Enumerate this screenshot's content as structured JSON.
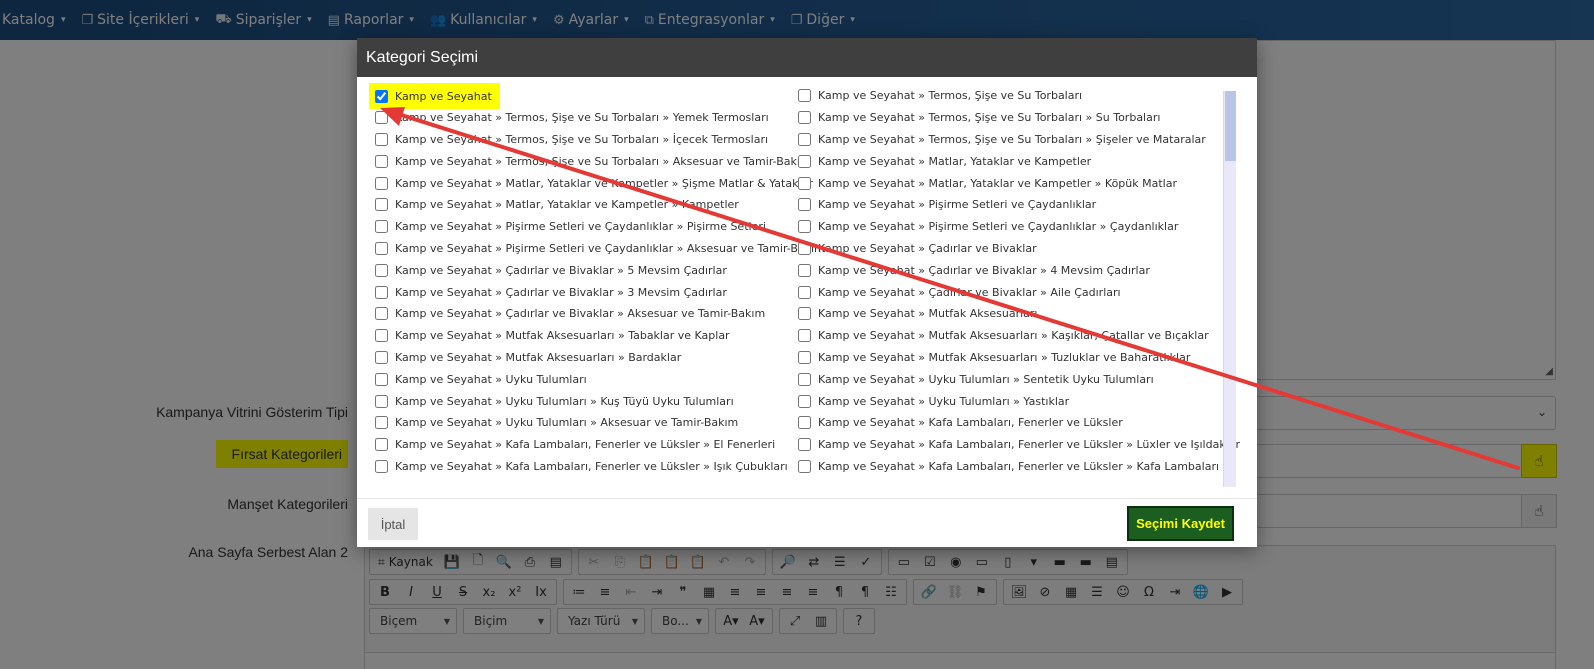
{
  "nav": {
    "items": [
      {
        "label": "Katalog",
        "icon": "none"
      },
      {
        "label": "Site İçerikleri",
        "icon": "copy-icon"
      },
      {
        "label": "Siparişler",
        "icon": "cart-icon"
      },
      {
        "label": "Raporlar",
        "icon": "document-icon"
      },
      {
        "label": "Kullanıcılar",
        "icon": "users-icon"
      },
      {
        "label": "Ayarlar",
        "icon": "gears-icon"
      },
      {
        "label": "Entegrasyonlar",
        "icon": "sitemap-icon"
      },
      {
        "label": "Diğer",
        "icon": "copy-icon"
      }
    ]
  },
  "form": {
    "kampanya_label": "Kampanya Vitrini Gösterim Tipi",
    "firsat_label": "Fırsat Kategorileri",
    "manset_label": "Manşet Kategorileri",
    "serbest_label": "Ana Sayfa Serbest Alan 2"
  },
  "editor": {
    "source_label": "Kaynak",
    "format_combo": "Biçem",
    "style_combo": "Biçim",
    "font_combo": "Yazı Türü",
    "size_combo": "Bo..."
  },
  "modal": {
    "title": "Kategori Seçimi",
    "cancel_label": "İptal",
    "save_label": "Seçimi Kaydet",
    "left_items": [
      {
        "label": "Kamp ve Seyahat",
        "checked": true
      },
      {
        "label": "Kamp ve Seyahat » Termos, Şişe ve Su Torbaları » Yemek Termosları",
        "checked": false
      },
      {
        "label": "Kamp ve Seyahat » Termos, Şişe ve Su Torbaları » İçecek Termosları",
        "checked": false
      },
      {
        "label": "Kamp ve Seyahat » Termos, Şişe ve Su Torbaları » Aksesuar ve Tamir-Bakım",
        "checked": false
      },
      {
        "label": "Kamp ve Seyahat » Matlar, Yataklar ve Kampetler » Şişme Matlar & Yataklar",
        "checked": false
      },
      {
        "label": "Kamp ve Seyahat » Matlar, Yataklar ve Kampetler » Kampetler",
        "checked": false
      },
      {
        "label": "Kamp ve Seyahat » Pişirme Setleri ve Çaydanlıklar » Pişirme Setleri",
        "checked": false
      },
      {
        "label": "Kamp ve Seyahat » Pişirme Setleri ve Çaydanlıklar » Aksesuar ve Tamir-Bakım",
        "checked": false
      },
      {
        "label": "Kamp ve Seyahat » Çadırlar ve Bivaklar » 5 Mevsim Çadırlar",
        "checked": false
      },
      {
        "label": "Kamp ve Seyahat » Çadırlar ve Bivaklar » 3 Mevsim Çadırlar",
        "checked": false
      },
      {
        "label": "Kamp ve Seyahat » Çadırlar ve Bivaklar » Aksesuar ve Tamir-Bakım",
        "checked": false
      },
      {
        "label": "Kamp ve Seyahat » Mutfak Aksesuarları » Tabaklar ve Kaplar",
        "checked": false
      },
      {
        "label": "Kamp ve Seyahat » Mutfak Aksesuarları » Bardaklar",
        "checked": false
      },
      {
        "label": "Kamp ve Seyahat » Uyku Tulumları",
        "checked": false
      },
      {
        "label": "Kamp ve Seyahat » Uyku Tulumları » Kuş Tüyü Uyku Tulumları",
        "checked": false
      },
      {
        "label": "Kamp ve Seyahat » Uyku Tulumları » Aksesuar ve Tamir-Bakım",
        "checked": false
      },
      {
        "label": "Kamp ve Seyahat » Kafa Lambaları, Fenerler ve Lüksler » El Fenerleri",
        "checked": false
      },
      {
        "label": "Kamp ve Seyahat » Kafa Lambaları, Fenerler ve Lüksler » Işık Çubukları",
        "checked": false
      }
    ],
    "right_items": [
      {
        "label": "Kamp ve Seyahat » Termos, Şişe ve Su Torbaları",
        "checked": false
      },
      {
        "label": "Kamp ve Seyahat » Termos, Şişe ve Su Torbaları » Su Torbaları",
        "checked": false
      },
      {
        "label": "Kamp ve Seyahat » Termos, Şişe ve Su Torbaları » Şişeler ve Mataralar",
        "checked": false
      },
      {
        "label": "Kamp ve Seyahat » Matlar, Yataklar ve Kampetler",
        "checked": false
      },
      {
        "label": "Kamp ve Seyahat » Matlar, Yataklar ve Kampetler » Köpük Matlar",
        "checked": false
      },
      {
        "label": "Kamp ve Seyahat » Pişirme Setleri ve Çaydanlıklar",
        "checked": false
      },
      {
        "label": "Kamp ve Seyahat » Pişirme Setleri ve Çaydanlıklar » Çaydanlıklar",
        "checked": false
      },
      {
        "label": "Kamp ve Seyahat » Çadırlar ve Bivaklar",
        "checked": false
      },
      {
        "label": "Kamp ve Seyahat » Çadırlar ve Bivaklar » 4 Mevsim Çadırlar",
        "checked": false
      },
      {
        "label": "Kamp ve Seyahat » Çadırlar ve Bivaklar » Aile Çadırları",
        "checked": false
      },
      {
        "label": "Kamp ve Seyahat » Mutfak Aksesuarları",
        "checked": false
      },
      {
        "label": "Kamp ve Seyahat » Mutfak Aksesuarları » Kaşıklar, Çatallar ve Bıçaklar",
        "checked": false
      },
      {
        "label": "Kamp ve Seyahat » Mutfak Aksesuarları » Tuzluklar ve Baharatlıklar",
        "checked": false
      },
      {
        "label": "Kamp ve Seyahat » Uyku Tulumları » Sentetik Uyku Tulumları",
        "checked": false
      },
      {
        "label": "Kamp ve Seyahat » Uyku Tulumları » Yastıklar",
        "checked": false
      },
      {
        "label": "Kamp ve Seyahat » Kafa Lambaları, Fenerler ve Lüksler",
        "checked": false
      },
      {
        "label": "Kamp ve Seyahat » Kafa Lambaları, Fenerler ve Lüksler » Lüxler ve Işıldaklar",
        "checked": false
      },
      {
        "label": "Kamp ve Seyahat » Kafa Lambaları, Fenerler ve Lüksler » Kafa Lambaları",
        "checked": false
      }
    ]
  },
  "colors": {
    "highlight": "#ffff00",
    "save_bg": "#1b5e20",
    "arrow": "#e53935"
  }
}
